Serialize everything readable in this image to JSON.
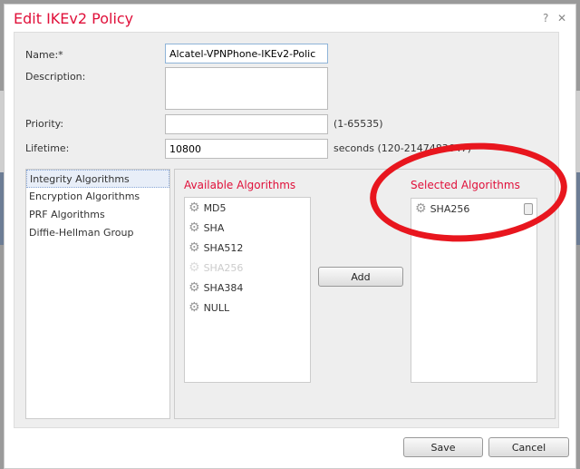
{
  "dialog": {
    "title": "Edit IKEv2 Policy",
    "help": "?",
    "close": "✕"
  },
  "form": {
    "name_label": "Name:*",
    "name_value": "Alcatel-VPNPhone-IKEv2-Polic",
    "description_label": "Description:",
    "description_value": "",
    "priority_label": "Priority:",
    "priority_value": "",
    "priority_hint": "(1-65535)",
    "lifetime_label": "Lifetime:",
    "lifetime_value": "10800",
    "lifetime_hint": "seconds (120-2147483647)"
  },
  "sidebar": {
    "items": [
      {
        "label": "Integrity Algorithms",
        "selected": true
      },
      {
        "label": "Encryption Algorithms"
      },
      {
        "label": "PRF Algorithms"
      },
      {
        "label": "Diffie-Hellman Group"
      }
    ]
  },
  "available": {
    "heading": "Available Algorithms",
    "items": [
      {
        "label": "MD5"
      },
      {
        "label": "SHA"
      },
      {
        "label": "SHA512"
      },
      {
        "label": "SHA256",
        "disabled": true
      },
      {
        "label": "SHA384"
      },
      {
        "label": "NULL"
      }
    ]
  },
  "selected": {
    "heading": "Selected Algorithms",
    "items": [
      {
        "label": "SHA256"
      }
    ]
  },
  "buttons": {
    "add": "Add",
    "save": "Save",
    "cancel": "Cancel"
  },
  "colors": {
    "accent": "#e0103a",
    "annotation": "#e8161e"
  }
}
